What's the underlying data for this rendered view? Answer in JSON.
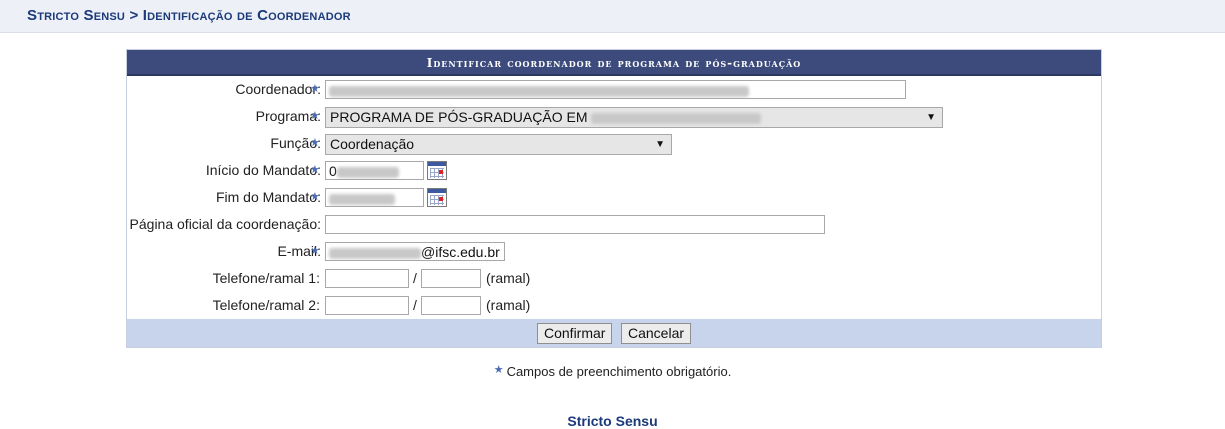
{
  "breadcrumb": "Stricto Sensu > Identificação de Coordenador",
  "form": {
    "caption": "Identificar coordenador de programa de pós-graduação",
    "fields": {
      "coordenador": {
        "label": "Coordenador:",
        "value": ""
      },
      "programa": {
        "label": "Programa:",
        "value": "PROGRAMA DE PÓS-GRADUAÇÃO EM"
      },
      "funcao": {
        "label": "Função:",
        "value": "Coordenação"
      },
      "inicio_mandato": {
        "label": "Início do Mandato:",
        "value": "0"
      },
      "fim_mandato": {
        "label": "Fim do Mandato:",
        "value": ""
      },
      "pagina_oficial": {
        "label": "Página oficial da coordenação:",
        "value": ""
      },
      "email": {
        "label": "E-mail:",
        "value": "@ifsc.edu.br"
      },
      "telefone1": {
        "label": "Telefone/ramal 1:",
        "separator": "/",
        "suffix": "(ramal)"
      },
      "telefone2": {
        "label": "Telefone/ramal 2:",
        "separator": "/",
        "suffix": "(ramal)"
      }
    },
    "buttons": {
      "confirm": "Confirmar",
      "cancel": "Cancelar"
    }
  },
  "required_note": "Campos de preenchimento obrigatório.",
  "footer_link": "Stricto Sensu",
  "icons": {
    "required": "star-icon",
    "calendar": "calendar-icon",
    "dropdown": "chevron-down-icon"
  },
  "colors": {
    "caption_bg": "#3d4b7c",
    "button_bar": "#c8d4ec",
    "link": "#1a3a7a",
    "star": "#4b6bb5"
  }
}
